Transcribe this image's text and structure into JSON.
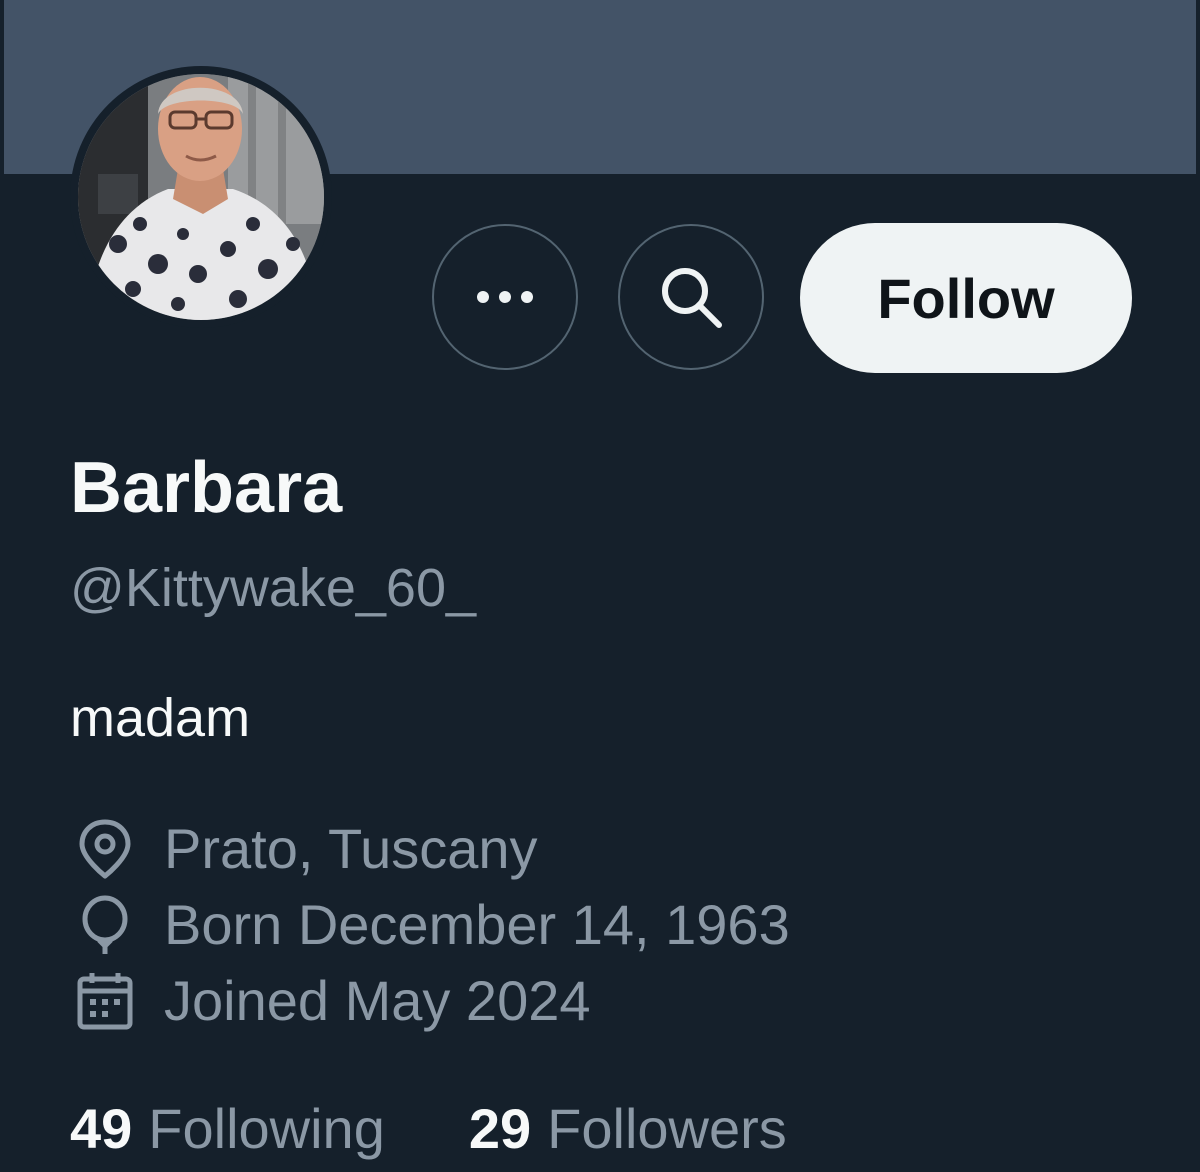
{
  "profile": {
    "display_name": "Barbara",
    "handle": "@Kittywake_60_",
    "bio": "madam",
    "location": "Prato, Tuscany",
    "born": "Born December 14, 1963",
    "joined": "Joined May 2024"
  },
  "actions": {
    "more_icon": "more-dots-icon",
    "search_icon": "search-icon",
    "follow_label": "Follow"
  },
  "stats": {
    "following_count": "49",
    "following_label": "Following",
    "followers_count": "29",
    "followers_label": "Followers"
  },
  "colors": {
    "background": "#15202b",
    "banner": "#435367",
    "primary_text": "#f7f9f9",
    "secondary_text": "#8b98a5",
    "button_border": "#536471",
    "follow_button_bg": "#eff3f4"
  }
}
